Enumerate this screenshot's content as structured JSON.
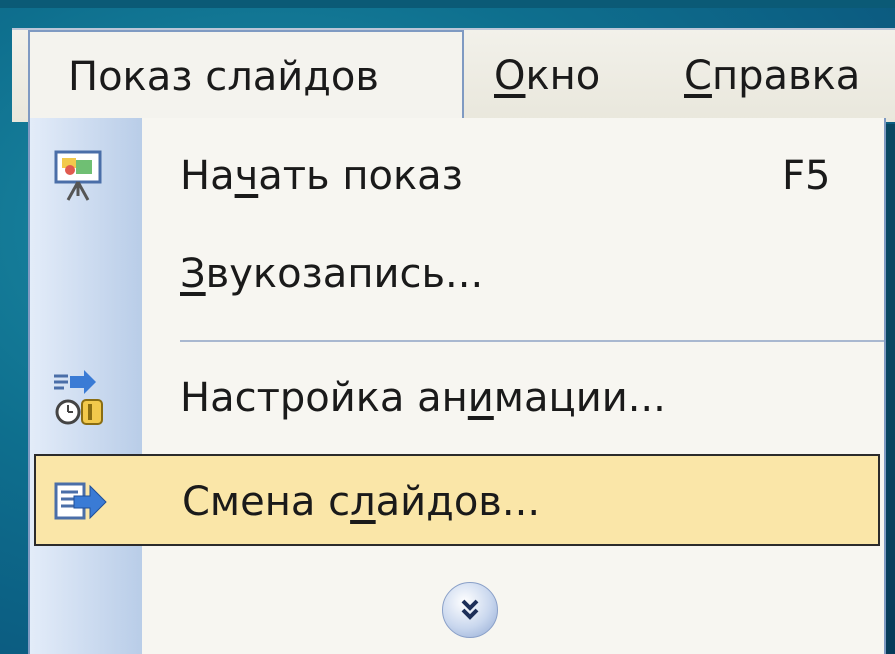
{
  "menubar": {
    "slideshow": {
      "label": "Показ слайдов"
    },
    "window": {
      "label_accel": "О",
      "label_rest": "кно"
    },
    "help": {
      "label_accel": "С",
      "label_rest": "правка"
    }
  },
  "dropdown": {
    "items": [
      {
        "label_pre": "На",
        "label_accel": "ч",
        "label_post": "ать показ",
        "shortcut": "F5",
        "icon": "start-slideshow-icon"
      },
      {
        "label_pre": "",
        "label_accel": "З",
        "label_post": "вукозапись...",
        "icon": ""
      },
      {
        "label_pre": "Настройка ан",
        "label_accel": "и",
        "label_post": "мации...",
        "icon": "custom-animation-icon"
      },
      {
        "label_pre": "Смена с",
        "label_accel": "л",
        "label_post": "айдов...",
        "icon": "slide-transition-icon",
        "highlighted": true
      }
    ],
    "expand_icon": "chevron-double-down-icon"
  },
  "colors": {
    "slide_background": "#0e6f8e",
    "highlight": "#fae6a8",
    "menu_background": "#f7f6f1",
    "gutter": "#b9cde8",
    "border": "#7f9ac2"
  }
}
